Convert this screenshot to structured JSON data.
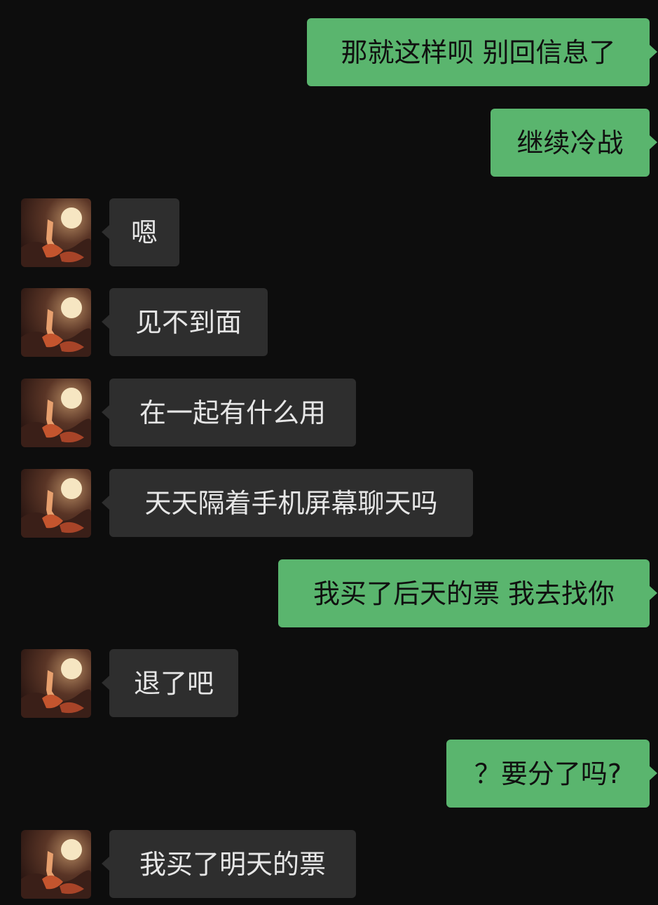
{
  "messages": [
    {
      "side": "out",
      "text": "那就这样呗 别回信息了"
    },
    {
      "side": "out",
      "text": "继续冷战"
    },
    {
      "side": "in",
      "text": "嗯"
    },
    {
      "side": "in",
      "text": "见不到面"
    },
    {
      "side": "in",
      "text": "在一起有什么用"
    },
    {
      "side": "in",
      "text": "天天隔着手机屏幕聊天吗"
    },
    {
      "side": "out",
      "text": "我买了后天的票 我去找你"
    },
    {
      "side": "in",
      "text": "退了吧"
    },
    {
      "side": "out",
      "text": "？要分了吗?"
    },
    {
      "side": "in",
      "text": "我买了明天的票"
    }
  ],
  "avatar": {
    "icon": "avatar-icon"
  },
  "colors": {
    "background": "#0d0d0d",
    "outgoing_bubble": "#5ab56e",
    "incoming_bubble": "#2e2e2e",
    "outgoing_text": "#101010",
    "incoming_text": "#e6e6e6"
  }
}
